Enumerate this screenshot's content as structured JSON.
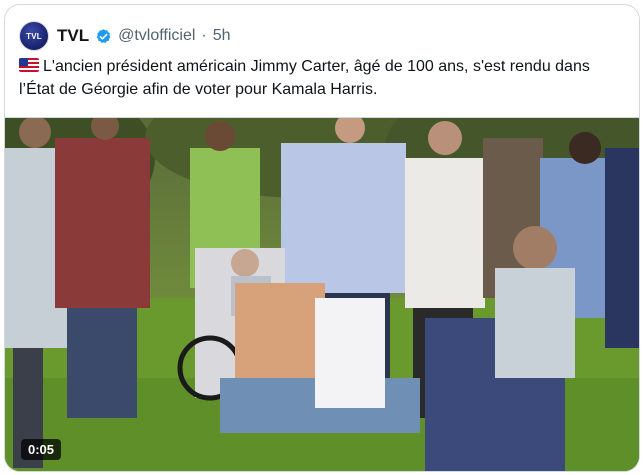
{
  "post": {
    "avatar_text": "TVL",
    "author_name": "TVL",
    "handle": "@tvlofficiel",
    "separator": "·",
    "time": "5h",
    "flag_icon": "us-flag-icon",
    "text": "L'ancien président américain Jimmy Carter, âgé de 100 ans, s'est rendu dans l’État de Géorgie afin de voter pour Kamala Harris."
  },
  "video": {
    "duration": "0:05"
  },
  "colors": {
    "border": "#cfd9de",
    "muted_text": "#536471",
    "verified_blue": "#1d9bf0"
  }
}
